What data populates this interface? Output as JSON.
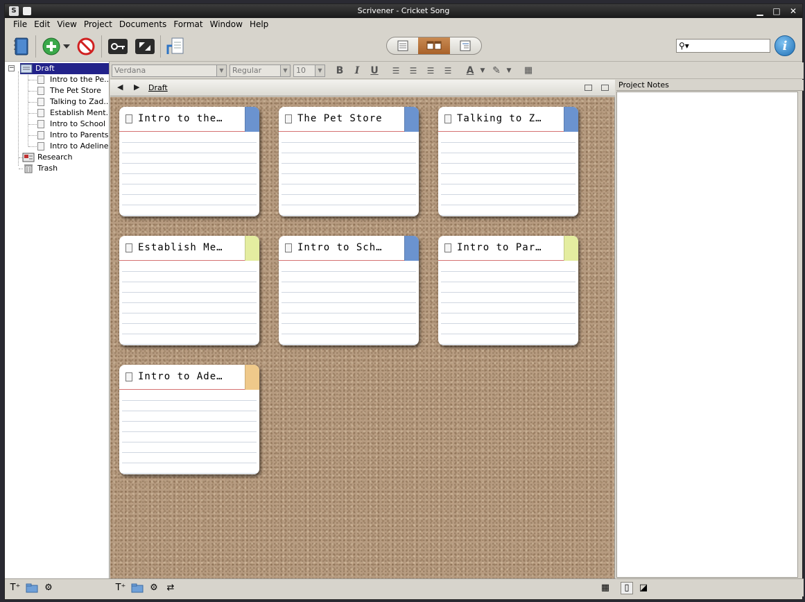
{
  "window": {
    "title": "Scrivener - Cricket Song"
  },
  "menu": [
    "File",
    "Edit",
    "View",
    "Project",
    "Documents",
    "Format",
    "Window",
    "Help"
  ],
  "binder": {
    "root": "Draft",
    "children": [
      "Intro to the Pe...",
      "The Pet Store",
      "Talking to Zad...",
      "Establish Ment...",
      "Intro to School",
      "Intro to Parents",
      "Intro to Adeline..."
    ],
    "research": "Research",
    "trash": "Trash"
  },
  "format_bar": {
    "font": "Verdana",
    "style": "Regular",
    "size": "10"
  },
  "header": {
    "breadcrumb": "Draft"
  },
  "cards": [
    {
      "title": "Intro to the…",
      "label_color": "#6b93cf"
    },
    {
      "title": "The Pet Store",
      "label_color": "#6b93cf"
    },
    {
      "title": "Talking to Z…",
      "label_color": "#6b93cf"
    },
    {
      "title": "Establish Me…",
      "label_color": "#e4eda0"
    },
    {
      "title": "Intro to Sch…",
      "label_color": "#6b93cf"
    },
    {
      "title": "Intro to Par…",
      "label_color": "#e4eda0"
    },
    {
      "title": "Intro to Ade…",
      "label_color": "#efc98a"
    }
  ],
  "notes": {
    "title": "Project Notes"
  },
  "colors": {
    "selection": "#22228a",
    "cork": "#b69b80",
    "title_bar": "#1a1a1a"
  }
}
